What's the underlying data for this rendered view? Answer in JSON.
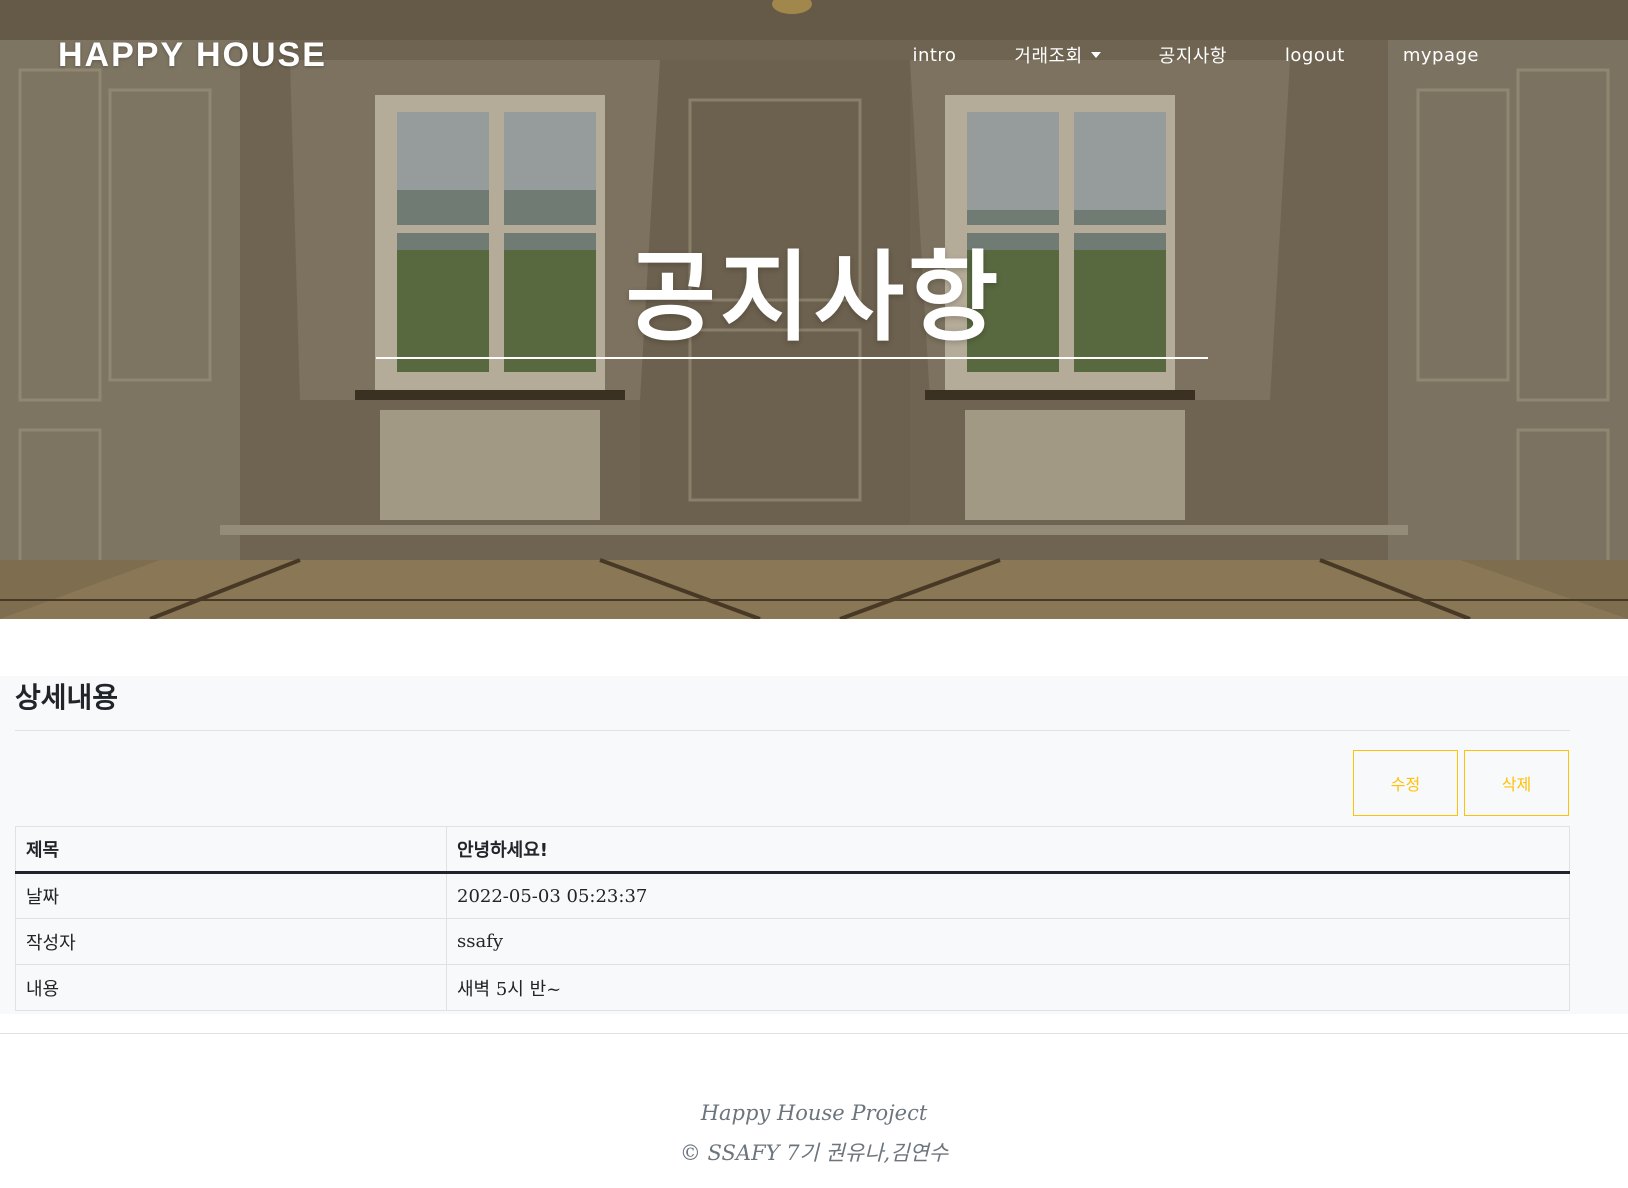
{
  "navbar": {
    "brand": "HAPPY HOUSE",
    "items": [
      {
        "label": "intro"
      },
      {
        "label": "거래조회",
        "has_dropdown": true
      },
      {
        "label": "공지사항"
      },
      {
        "label": "logout"
      },
      {
        "label": "mypage"
      }
    ]
  },
  "hero": {
    "title": "공지사항"
  },
  "detail": {
    "section_title": "상세내용",
    "buttons": {
      "edit": "수정",
      "delete": "삭제"
    },
    "header": {
      "key": "제목",
      "value": "안녕하세요!"
    },
    "rows": [
      {
        "key": "날짜",
        "value": "2022-05-03 05:23:37"
      },
      {
        "key": "작성자",
        "value": "ssafy"
      },
      {
        "key": "내용",
        "value": "새벽 5시 반~"
      }
    ]
  },
  "footer": {
    "line1": "Happy House Project",
    "line2": "© SSAFY 7기 권유나,김연수"
  },
  "colors": {
    "accent": "#ffc107",
    "text": "#212529",
    "muted": "#6c757d",
    "content_bg": "#f8f9fa"
  }
}
